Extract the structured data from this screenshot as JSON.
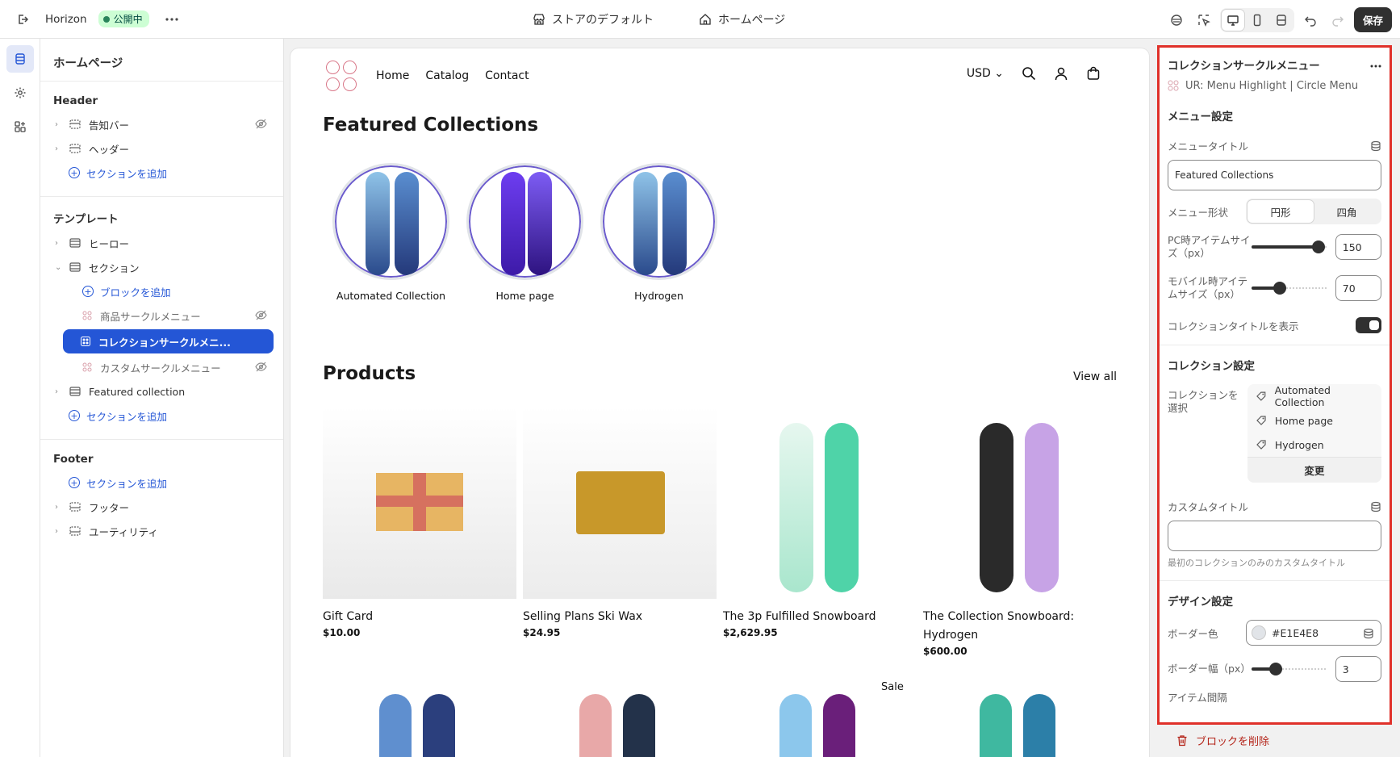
{
  "topbar": {
    "theme_name": "Horizon",
    "live_badge": "公開中",
    "store_default": "ストアのデフォルト",
    "homepage": "ホームページ",
    "save_label": "保存"
  },
  "tree": {
    "title": "ホームページ",
    "header_group": "Header",
    "header_items": [
      "告知バー",
      "ヘッダー"
    ],
    "add_section": "セクションを追加",
    "template_group": "テンプレート",
    "hero": "ヒーロー",
    "section": "セクション",
    "add_block": "ブロックを追加",
    "blocks": [
      "商品サークルメニュー",
      "コレクションサークルメニ...",
      "カスタムサークルメニュー"
    ],
    "featured_collection": "Featured collection",
    "footer_group": "Footer",
    "footer_items": [
      "フッター",
      "ユーティリティ"
    ]
  },
  "preview": {
    "nav": [
      "Home",
      "Catalog",
      "Contact"
    ],
    "currency": "USD",
    "featured_title": "Featured Collections",
    "circles": [
      "Automated Collection",
      "Home page",
      "Hydrogen"
    ],
    "products_title": "Products",
    "view_all": "View all",
    "products": [
      {
        "name": "Gift Card",
        "price": "$10.00"
      },
      {
        "name": "Selling Plans Ski Wax",
        "price": "$24.95"
      },
      {
        "name": "The 3p Fulfilled Snowboard",
        "price": "$2,629.95"
      },
      {
        "name": "The Collection Snowboard: Hydrogen",
        "price": "$600.00"
      }
    ],
    "sale_label": "Sale"
  },
  "settings": {
    "title": "コレクションサークルメニュー",
    "subtitle": "UR: Menu Highlight | Circle Menu",
    "menu_settings": "メニュー設定",
    "menu_title_label": "メニュータイトル",
    "menu_title_value": "Featured Collections",
    "shape_label": "メニュー形状",
    "shape_options": [
      "円形",
      "四角"
    ],
    "pc_size_label": "PC時アイテムサイズ（px）",
    "pc_size_value": "150",
    "pc_size_fraction": 0.88,
    "mobile_size_label": "モバイル時アイテムサイズ（px）",
    "mobile_size_value": "70",
    "mobile_size_fraction": 0.37,
    "show_title_label": "コレクションタイトルを表示",
    "collection_settings": "コレクション設定",
    "select_collection_label": "コレクションを選択",
    "collections": [
      "Automated Collection",
      "Home page",
      "Hydrogen"
    ],
    "change_label": "変更",
    "custom_title_label": "カスタムタイトル",
    "custom_title_value": "",
    "custom_title_hint": "最初のコレクションのみのカスタムタイトル",
    "design_settings": "デザイン設定",
    "border_color_label": "ボーダー色",
    "border_color_value": "#E1E4E8",
    "border_width_label": "ボーダー幅（px）",
    "border_width_value": "3",
    "border_width_fraction": 0.32,
    "item_gap_label": "アイテム間隔",
    "delete_label": "ブロックを削除"
  },
  "colors": {
    "accent": "#2456d6",
    "highlight_border": "#e0312a",
    "live": "#29845a"
  }
}
